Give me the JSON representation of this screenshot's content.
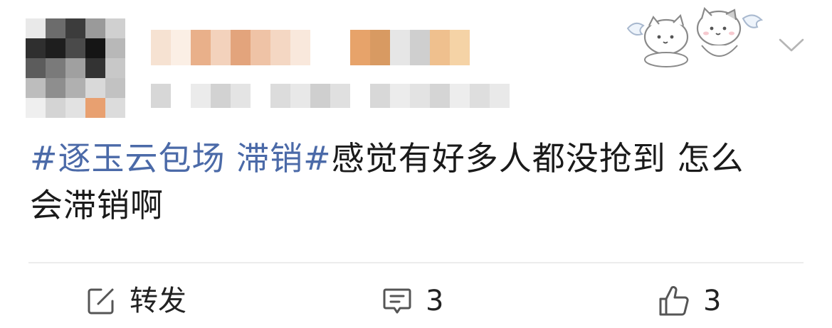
{
  "post": {
    "hashtag": "#逐玉云包场 滞销#",
    "body_line1": "感觉有好多人都没抢到 怎么",
    "body_line2": "会滞销啊"
  },
  "header": {
    "username": "",
    "meta": "",
    "icons": [
      "avatar",
      "cat-sticker-icon",
      "chevron-down-icon"
    ]
  },
  "actions": {
    "forward_label": "转发",
    "comment_count": "3",
    "like_count": "3",
    "icons": [
      "share-icon",
      "comment-icon",
      "thumbs-up-icon"
    ]
  },
  "colors": {
    "hashtag": "#4b6aa8",
    "text": "#1a1a1a",
    "icon": "#555555",
    "divider": "#ececec"
  }
}
